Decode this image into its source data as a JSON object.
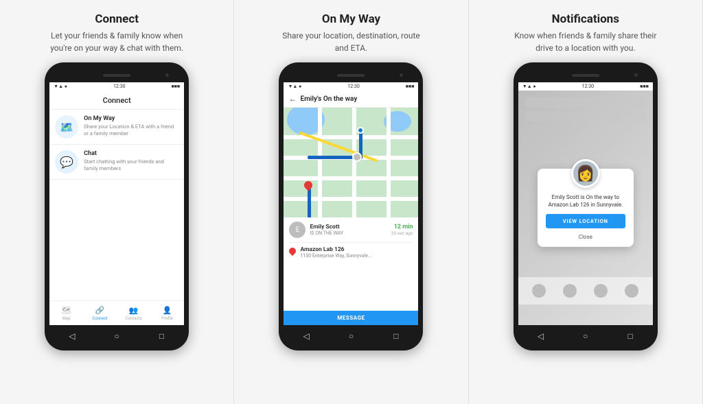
{
  "section1": {
    "title": "Connect",
    "description": "Let your friends & family know when you're on your way & chat with them.",
    "screen_title": "Connect",
    "item1": {
      "label": "On My Way",
      "desc": "Share your Location & ETA with a friend or a family member",
      "icon": "🗺️"
    },
    "item2": {
      "label": "Chat",
      "desc": "Start chatting with your friends and family members",
      "icon": "💬"
    },
    "nav": {
      "map": "Map",
      "connect": "Connect",
      "contacts": "Contacts",
      "profile": "Profile"
    }
  },
  "section2": {
    "title": "On My Way",
    "description": "Share your location, destination, route and ETA.",
    "screen_title": "Emily's On the way",
    "person": {
      "name": "Emily Scott",
      "status": "IS ON THE WAY",
      "eta": "12 min",
      "ago": "20 sec ago",
      "avatar_letter": "E"
    },
    "destination": {
      "name": "Amazon Lab 126",
      "address": "1100 Enterprise Way, Sunnyvale..."
    },
    "message_btn": "MESSAGE"
  },
  "section3": {
    "title": "Notifications",
    "description": "Know when friends & family share their drive to a location with you.",
    "notification": {
      "message": "Emily Scott is On the way to Amazon Lab 126 in Sunnyvale.",
      "view_btn": "VIEW LOCATION",
      "close_btn": "Close"
    }
  },
  "status_bar": {
    "time": "12:30",
    "signal": "▲▼",
    "wifi": "WiFi",
    "battery": "🔋"
  },
  "nav_buttons": {
    "back": "◁",
    "home": "○",
    "recent": "□"
  }
}
